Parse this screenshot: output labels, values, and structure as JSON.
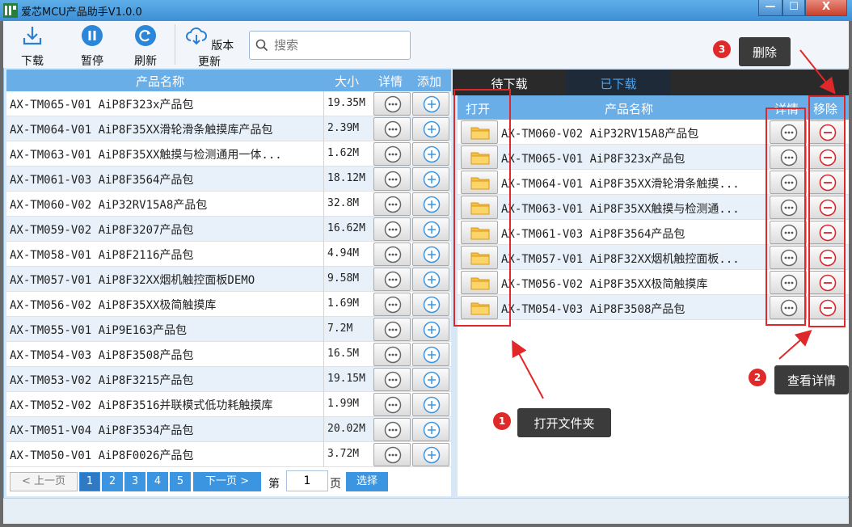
{
  "app": {
    "title": "爱芯MCU产品助手V1.0.0",
    "window_controls": {
      "minimize": "—",
      "maximize": "☐",
      "close": "X"
    }
  },
  "toolbar": {
    "download_label": "下载",
    "pause_label": "暂停",
    "refresh_label": "刷新",
    "update_label": "版本更新",
    "search_placeholder": "搜索"
  },
  "left_table": {
    "headers": {
      "name": "产品名称",
      "size": "大小",
      "detail": "详情",
      "add": "添加"
    },
    "rows": [
      {
        "name": "AX-TM065-V01 AiP8F323x产品包",
        "size": "19.35M"
      },
      {
        "name": "AX-TM064-V01 AiP8F35XX滑轮滑条触摸库产品包",
        "size": "2.39M"
      },
      {
        "name": "AX-TM063-V01 AiP8F35XX触摸与检测通用一体...",
        "size": "1.62M"
      },
      {
        "name": "AX-TM061-V03 AiP8F3564产品包",
        "size": "18.12M"
      },
      {
        "name": "AX-TM060-V02 AiP32RV15A8产品包",
        "size": "32.8M"
      },
      {
        "name": "AX-TM059-V02 AiP8F3207产品包",
        "size": "16.62M"
      },
      {
        "name": "AX-TM058-V01 AiP8F2116产品包",
        "size": "4.94M"
      },
      {
        "name": "AX-TM057-V01 AiP8F32XX烟机触控面板DEMO",
        "size": "9.58M"
      },
      {
        "name": "AX-TM056-V02 AiP8F35XX极简触摸库",
        "size": "1.69M"
      },
      {
        "name": "AX-TM055-V01 AiP9E163产品包",
        "size": "7.2M"
      },
      {
        "name": "AX-TM054-V03 AiP8F3508产品包",
        "size": "16.5M"
      },
      {
        "name": "AX-TM053-V02 AiP8F3215产品包",
        "size": "19.15M"
      },
      {
        "name": "AX-TM052-V02 AiP8F3516并联模式低功耗触摸库",
        "size": "1.99M"
      },
      {
        "name": "AX-TM051-V04 AiP8F3534产品包",
        "size": "20.02M"
      },
      {
        "name": "AX-TM050-V01 AiP8F0026产品包",
        "size": "3.72M"
      }
    ]
  },
  "pagination": {
    "prev_label": "< 上一页",
    "pages": [
      "1",
      "2",
      "3",
      "4",
      "5"
    ],
    "next_label": "下一页 >",
    "goto_prefix": "第",
    "goto_value": "1",
    "goto_suffix": "页",
    "select_label": "选择"
  },
  "right_panel": {
    "tabs": {
      "pending": "待下载",
      "downloaded": "已下载"
    },
    "headers": {
      "open": "打开",
      "name": "产品名称",
      "detail": "详情",
      "remove": "移除"
    },
    "rows": [
      {
        "name": "AX-TM060-V02 AiP32RV15A8产品包"
      },
      {
        "name": "AX-TM065-V01 AiP8F323x产品包"
      },
      {
        "name": "AX-TM064-V01 AiP8F35XX滑轮滑条触摸..."
      },
      {
        "name": "AX-TM063-V01 AiP8F35XX触摸与检测通..."
      },
      {
        "name": "AX-TM061-V03 AiP8F3564产品包"
      },
      {
        "name": "AX-TM057-V01 AiP8F32XX烟机触控面板..."
      },
      {
        "name": "AX-TM056-V02 AiP8F35XX极简触摸库"
      },
      {
        "name": "AX-TM054-V03 AiP8F3508产品包"
      }
    ]
  },
  "annotations": {
    "callout_1": {
      "number": "1",
      "text": "打开文件夹"
    },
    "callout_2": {
      "number": "2",
      "text": "查看详情"
    },
    "callout_3": {
      "number": "3",
      "text": "删除"
    }
  },
  "colors": {
    "header_blue": "#6aaee8",
    "accent_blue": "#3c95e0",
    "annotation_red": "#e0282a",
    "remove_red": "#d9282a"
  },
  "icons": {
    "download": "download-icon",
    "pause": "pause-icon",
    "refresh": "refresh-icon",
    "update": "cloud-download-icon",
    "search": "search-icon",
    "detail": "more-dots-icon",
    "add": "plus-circle-icon",
    "folder": "folder-icon",
    "remove": "minus-circle-icon"
  }
}
